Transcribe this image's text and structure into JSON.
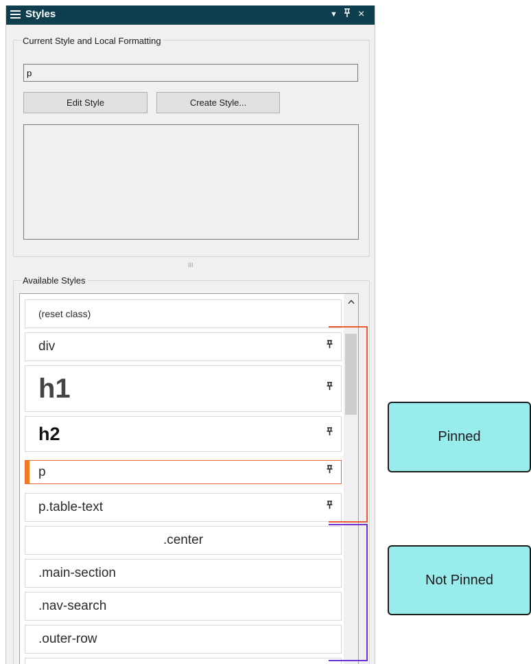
{
  "panel": {
    "title": "Styles",
    "titlebar_buttons": {
      "menu": "▼",
      "pin": "F",
      "close": "×"
    }
  },
  "current": {
    "legend": "Current Style and Local Formatting",
    "style_value": "p",
    "edit_label": "Edit Style",
    "create_label": "Create Style..."
  },
  "splitter": "III",
  "available": {
    "legend": "Available Styles",
    "items": [
      {
        "label": "(reset class)",
        "pinned": false
      },
      {
        "label": "div",
        "pinned": true
      },
      {
        "label": "h1",
        "pinned": true
      },
      {
        "label": "h2",
        "pinned": true
      },
      {
        "label": "p",
        "pinned": true,
        "selected": true
      },
      {
        "label": "p.table-text",
        "pinned": true
      },
      {
        "label": ".center",
        "pinned": false
      },
      {
        "label": ".main-section",
        "pinned": false
      },
      {
        "label": ".nav-search",
        "pinned": false
      },
      {
        "label": ".outer-row",
        "pinned": false
      }
    ],
    "pin_glyph": "†"
  },
  "callouts": {
    "pinned_label": "Pinned",
    "not_pinned_label": "Not Pinned"
  },
  "colors": {
    "titlebar": "#0f3f4f",
    "selected_accent": "#f07d22",
    "pinned_bracket": "#e85a2c",
    "not_pinned_bracket": "#6a2fd6",
    "callout_fill": "#98ecec"
  }
}
